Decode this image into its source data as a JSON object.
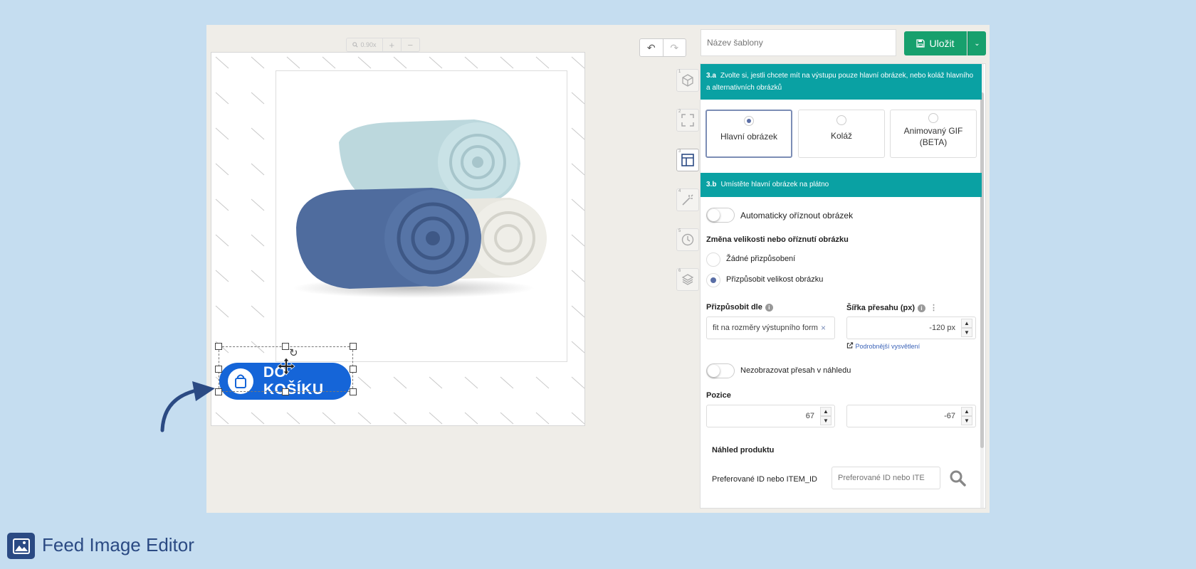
{
  "canvas": {
    "zoom": "0.90x",
    "zoom_in": "+",
    "zoom_out": "−",
    "overlay_button_label": "DO KOŠÍKU"
  },
  "toolbar": {
    "undo": "↶",
    "redo": "↷",
    "template_placeholder": "Název šablony",
    "save_label": "Uložit",
    "save_dropdown": "⌄"
  },
  "steps": [
    "1",
    "2",
    "3",
    "4",
    "5",
    "6"
  ],
  "panel": {
    "sec_a_num": "3.a",
    "sec_a_text": "Zvolte si, jestli chcete mít na výstupu pouze hlavní obrázek, nebo koláž hlavního a alternativních obrázků",
    "choices": [
      "Hlavní obrázek",
      "Koláž",
      "Animovaný GIF (BETA)"
    ],
    "selected_choice": "Hlavní obrázek",
    "sec_b_num": "3.b",
    "sec_b_text": "Umístěte hlavní obrázek na plátno",
    "auto_crop_label": "Automaticky oříznout obrázek",
    "resize_heading": "Změna velikosti nebo oříznutí obrázku",
    "resize_options": [
      "Žádné přizpůsobení",
      "Přizpůsobit velikost obrázku"
    ],
    "resize_selected": "Přizpůsobit velikost obrázku",
    "fit_by_label": "Přizpůsobit dle",
    "fit_by_value": "fit na rozměry výstupního form",
    "fit_clear": "×",
    "overflow_label": "Šířka přesahu (px)",
    "overflow_value": "-120 px",
    "details_link": "Podrobnější vysvětlení",
    "hide_overflow_label": "Nezobrazovat přesah v náhledu",
    "position_label": "Pozice",
    "position_x": "67",
    "position_y": "-67",
    "preview_heading": "Náhled produktu",
    "preferred_id_label": "Preferované ID nebo ITEM_ID",
    "preferred_id_placeholder": "Preferované ID nebo ITE"
  },
  "footer": {
    "title": "Feed Image Editor"
  },
  "colors": {
    "background": "#c5ddf0",
    "teal": "#0aa1a3",
    "save_green": "#17a06d",
    "cart_blue": "#1565d8",
    "brand_navy": "#2b4a83"
  }
}
